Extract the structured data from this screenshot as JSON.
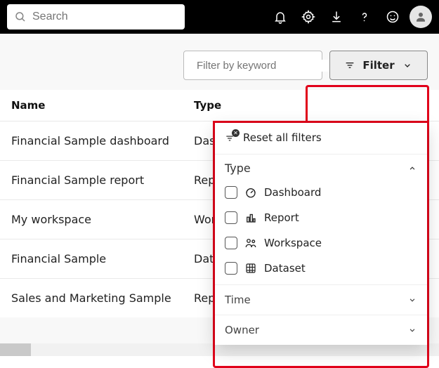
{
  "topbar": {
    "search_placeholder": "Search"
  },
  "toolbar": {
    "keyword_placeholder": "Filter by keyword",
    "filter_label": "Filter"
  },
  "table": {
    "headers": {
      "name": "Name",
      "type": "Type"
    },
    "rows": [
      {
        "name": "Financial Sample dashboard",
        "type": "Dashboard"
      },
      {
        "name": "Financial Sample report",
        "type": "Report"
      },
      {
        "name": "My workspace",
        "type": "Workspace"
      },
      {
        "name": "Financial Sample",
        "type": "Dataset"
      },
      {
        "name": "Sales and Marketing Sample",
        "type": "Report"
      }
    ]
  },
  "filter_panel": {
    "reset_label": "Reset all filters",
    "sections": {
      "type": {
        "label": "Type",
        "expanded": true,
        "options": [
          "Dashboard",
          "Report",
          "Workspace",
          "Dataset"
        ]
      },
      "time": {
        "label": "Time",
        "expanded": false
      },
      "owner": {
        "label": "Owner",
        "expanded": false
      }
    }
  }
}
